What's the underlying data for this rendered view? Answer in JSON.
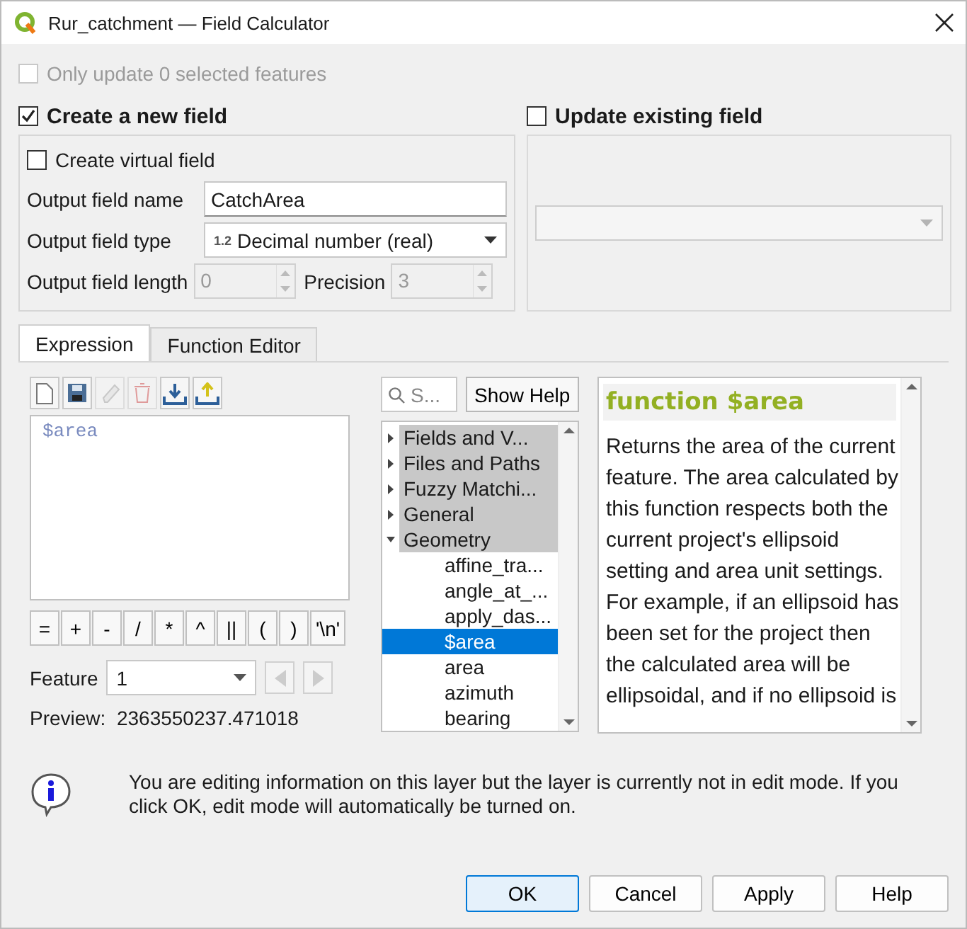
{
  "window": {
    "title": "Rur_catchment — Field Calculator"
  },
  "only_selected": {
    "label": "Only update 0 selected features",
    "checked": false,
    "disabled": true
  },
  "create_new": {
    "label": "Create a new field",
    "checked": true
  },
  "virtual": {
    "label": "Create virtual field",
    "checked": false
  },
  "field_name": {
    "label": "Output field name",
    "value": "CatchArea"
  },
  "field_type": {
    "label": "Output field type",
    "badge": "1.2",
    "value": "Decimal number (real)"
  },
  "field_length": {
    "label": "Output field length",
    "value": "0",
    "disabled": true
  },
  "precision": {
    "label": "Precision",
    "value": "3",
    "disabled": true
  },
  "update_existing": {
    "label": "Update existing field",
    "checked": false
  },
  "tabs": [
    {
      "label": "Expression",
      "selected": true
    },
    {
      "label": "Function Editor",
      "selected": false
    }
  ],
  "editor_tools": [
    {
      "kind": "new",
      "disabled": false
    },
    {
      "kind": "save",
      "disabled": false
    },
    {
      "kind": "edit",
      "disabled": true
    },
    {
      "kind": "delete",
      "disabled": true
    },
    {
      "kind": "import",
      "disabled": false
    },
    {
      "kind": "export",
      "disabled": false
    }
  ],
  "expression": "$area",
  "operators": [
    "=",
    "+",
    "-",
    "/",
    "*",
    "^",
    "||",
    "(",
    ")",
    "'\\n'"
  ],
  "feature": {
    "label": "Feature",
    "value": "1"
  },
  "preview": {
    "label": "Preview:",
    "value": "2363550237.471018"
  },
  "search": {
    "placeholder": "S..."
  },
  "show_help": "Show Help",
  "tree": [
    {
      "label": "Fields and V...",
      "expanded": false
    },
    {
      "label": "Files and Paths",
      "expanded": false
    },
    {
      "label": "Fuzzy Matchi...",
      "expanded": false
    },
    {
      "label": "General",
      "expanded": false
    },
    {
      "label": "Geometry",
      "expanded": true,
      "children": [
        {
          "label": "affine_tra...",
          "selected": false
        },
        {
          "label": "angle_at_...",
          "selected": false
        },
        {
          "label": "apply_das...",
          "selected": false
        },
        {
          "label": "$area",
          "selected": true
        },
        {
          "label": "area",
          "selected": false
        },
        {
          "label": "azimuth",
          "selected": false
        },
        {
          "label": "bearing",
          "selected": false
        }
      ]
    }
  ],
  "help": {
    "title": "function $area",
    "text": "Returns the area of the current feature. The area calculated by this function respects both the current project's ellipsoid setting and area unit settings. For example, if an ellipsoid has been set for the project then the calculated area will be ellipsoidal, and if no ellipsoid is"
  },
  "message": "You are editing information on this layer but the layer is currently not in edit mode. If you click OK, edit mode will automatically be turned on.",
  "buttons": [
    {
      "label": "OK",
      "default": true
    },
    {
      "label": "Cancel",
      "default": false
    },
    {
      "label": "Apply",
      "default": false
    },
    {
      "label": "Help",
      "default": false
    }
  ]
}
